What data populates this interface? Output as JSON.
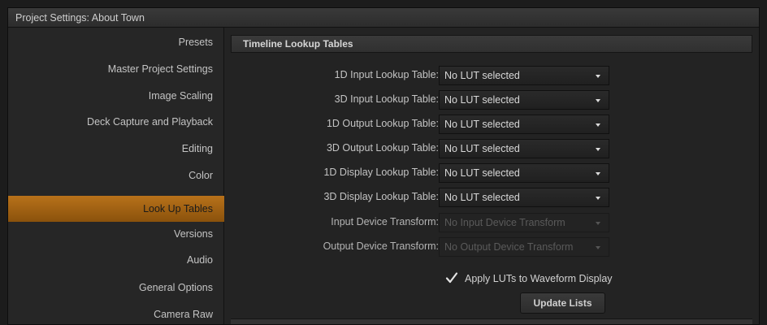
{
  "window": {
    "title": "Project Settings:  About Town"
  },
  "sidebar": {
    "items": [
      {
        "label": "Presets",
        "active": false
      },
      {
        "label": "Master Project Settings",
        "active": false
      },
      {
        "label": "Image Scaling",
        "active": false
      },
      {
        "label": "Deck Capture and Playback",
        "active": false
      },
      {
        "label": "Editing",
        "active": false
      },
      {
        "label": "Color",
        "active": false
      },
      {
        "label": "Look Up Tables",
        "active": true
      },
      {
        "label": "Versions",
        "active": false
      },
      {
        "label": "Audio",
        "active": false
      },
      {
        "label": "General Options",
        "active": false
      },
      {
        "label": "Camera Raw",
        "active": false
      }
    ]
  },
  "main": {
    "section_title": "Timeline Lookup Tables",
    "rows": [
      {
        "label": "1D Input Lookup Table:",
        "value": "No LUT selected",
        "enabled": true
      },
      {
        "label": "3D Input Lookup Table:",
        "value": "No LUT selected",
        "enabled": true
      },
      {
        "label": "1D Output Lookup Table:",
        "value": "No LUT selected",
        "enabled": true
      },
      {
        "label": "3D Output Lookup Table:",
        "value": "No LUT selected",
        "enabled": true
      },
      {
        "label": "1D Display Lookup Table:",
        "value": "No LUT selected",
        "enabled": true
      },
      {
        "label": "3D Display Lookup Table:",
        "value": "No LUT selected",
        "enabled": true
      },
      {
        "label": "Input Device Transform:",
        "value": "No Input Device Transform",
        "enabled": false
      },
      {
        "label": "Output Device Transform:",
        "value": "No Output Device Transform",
        "enabled": false
      }
    ],
    "apply_luts": {
      "label": "Apply LUTs to Waveform Display",
      "checked": true
    },
    "update_button": "Update Lists"
  },
  "colors": {
    "accent": "#b8721a",
    "background": "#232323",
    "sidebar": "#262626"
  }
}
